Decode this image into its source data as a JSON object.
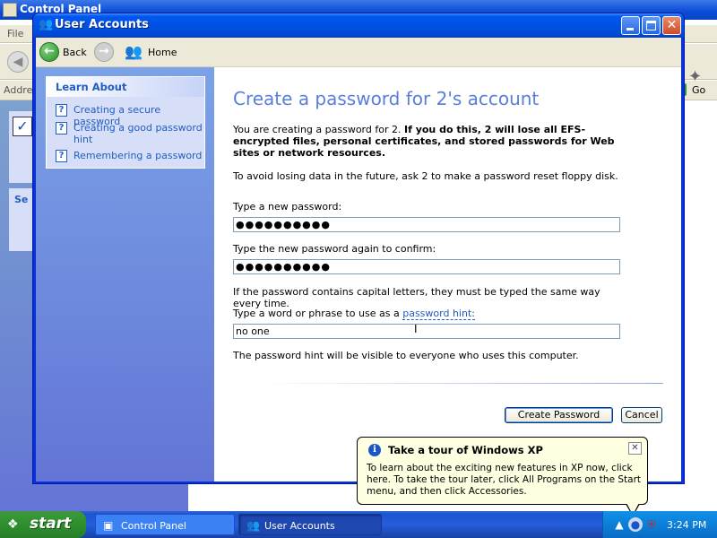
{
  "background_window": {
    "title": "Control Panel",
    "menu_file": "File",
    "address_label": "Address",
    "go_label": "Go",
    "left_pane_partial": "Se"
  },
  "window": {
    "title": "User Accounts",
    "minimize_icon": "minimize-icon",
    "maximize_icon": "maximize-icon",
    "close_icon": "close-icon"
  },
  "nav": {
    "back_label": "Back",
    "forward_icon": "forward-arrow-icon",
    "home_label": "Home"
  },
  "sidebar": {
    "heading": "Learn About",
    "items": [
      {
        "label": "Creating a secure password",
        "icon": "help-icon"
      },
      {
        "label": "Creating a good password hint",
        "icon": "help-icon"
      },
      {
        "label": "Remembering a password",
        "icon": "help-icon"
      }
    ]
  },
  "main": {
    "title": "Create a password for 2's account",
    "intro_plain": "You are creating a password for 2. ",
    "intro_bold": "If you do this, 2 will lose all EFS-encrypted files, personal certificates, and stored passwords for Web sites or network resources.",
    "reset_note": "To avoid losing data in the future, ask 2 to make a password reset floppy disk.",
    "new_password_label": "Type a new password:",
    "new_password_value": "●●●●●●●●●●",
    "confirm_password_label": "Type the new password again to confirm:",
    "confirm_password_value": "●●●●●●●●●●",
    "caps_note": "If the password contains capital letters, they must be typed the same way every time.",
    "hint_label_prefix": "Type a word or phrase to use as a ",
    "hint_link": "password hint:",
    "hint_value": "no one",
    "visible_note": "The password hint will be visible to everyone who uses this computer.",
    "create_button": "Create Password",
    "cancel_button": "Cancel"
  },
  "balloon": {
    "title": "Take a tour of Windows XP",
    "body": "To learn about the exciting new features in XP now, click here. To take the tour later, click All Programs on the Start menu, and then click Accessories.",
    "close_icon": "close-icon"
  },
  "taskbar": {
    "start_label": "start",
    "tasks": [
      {
        "label": "Control Panel",
        "active": false
      },
      {
        "label": "User Accounts",
        "active": true
      }
    ],
    "clock": "3:24 PM"
  }
}
